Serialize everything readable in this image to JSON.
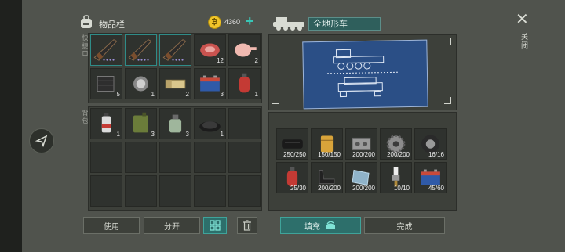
{
  "inventory": {
    "title": "物品栏",
    "coins": "4360",
    "coin_symbol": "₿",
    "plus": "+"
  },
  "labels": {
    "quick_slots": "快捷口",
    "backpack": "背包"
  },
  "vehicle": {
    "name": "全地形车"
  },
  "close_label": "关闭",
  "quick_items": [
    {
      "icon": "rifle-icon",
      "qty": ""
    },
    {
      "icon": "rifle-icon",
      "qty": ""
    },
    {
      "icon": "rifle-icon",
      "qty": ""
    },
    {
      "icon": "raw-meat-icon",
      "qty": "12"
    },
    {
      "icon": "chicken-icon",
      "qty": "2"
    },
    {
      "icon": "metal-sheet-icon",
      "qty": "5"
    },
    {
      "icon": "lens-icon",
      "qty": "1"
    },
    {
      "icon": "cigarettes-icon",
      "qty": "2"
    },
    {
      "icon": "battery-icon",
      "qty": "3"
    },
    {
      "icon": "gas-cylinder-icon",
      "qty": "1"
    }
  ],
  "backpack_items": [
    {
      "icon": "spray-can-icon",
      "qty": "1"
    },
    {
      "icon": "jerrycan-icon",
      "qty": "3"
    },
    {
      "icon": "bottle-icon",
      "qty": "3"
    },
    {
      "icon": "gravel-icon",
      "qty": "1"
    }
  ],
  "parts": [
    {
      "icon": "rubber-icon",
      "value": "250/250"
    },
    {
      "icon": "oil-filter-icon",
      "value": "150/150"
    },
    {
      "icon": "engine-block-icon",
      "value": "200/200"
    },
    {
      "icon": "gear-icon",
      "value": "200/200"
    },
    {
      "icon": "wheel-icon",
      "value": "16/16"
    },
    {
      "icon": "gas-cylinder-icon",
      "value": "25/30"
    },
    {
      "icon": "seat-icon",
      "value": "200/200"
    },
    {
      "icon": "glass-icon",
      "value": "200/200"
    },
    {
      "icon": "spark-plug-icon",
      "value": "10/10"
    },
    {
      "icon": "battery-icon",
      "value": "45/60"
    }
  ],
  "buttons": {
    "use": "使用",
    "split": "分开",
    "fill": "填充",
    "done": "完成"
  }
}
